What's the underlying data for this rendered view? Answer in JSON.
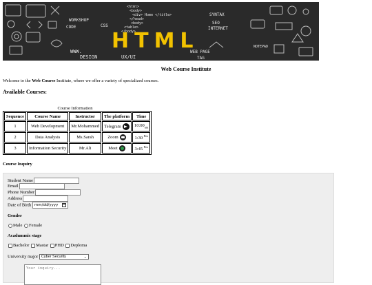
{
  "banner": {
    "title": "HTML",
    "words": [
      "<html>",
      "<body>",
      "<div>",
      "Home",
      "</title>",
      "</head>",
      "<body>",
      "<table>",
      "</body>",
      "</html>",
      "WORKSHOP",
      "CODE",
      "CSS",
      "SYNTAX",
      "SEO",
      "INTERNET",
      "HTML",
      "NOTEPAD",
      "WWW.",
      "DESIGN",
      "UX/UI",
      "WEB PAGE",
      "TAG"
    ]
  },
  "site": {
    "title": "Web Course Institute",
    "welcome_prefix": "Welcome to the ",
    "welcome_brand": "Web Course",
    "welcome_suffix": " Institute, where we offer a variety of specialized courses."
  },
  "courses": {
    "heading": "Available Courses:",
    "caption": "Course Information",
    "headers": [
      "Sequence",
      "Course Name",
      "Instructor",
      "The platform",
      "Time"
    ],
    "rows": [
      {
        "seq": "1",
        "name": "Web Development",
        "instructor": "Mr.Mohammed",
        "platform": "Telegram",
        "platform_icon": "telegram-icon",
        "time": "10:00",
        "time_suffix": "am",
        "suffix_pos": "sub"
      },
      {
        "seq": "2",
        "name": "Data Analysis",
        "instructor": "Ms.Sarah",
        "platform": "Zoom",
        "platform_icon": "zoom-icon",
        "time": "1:30",
        "time_suffix": "Pm",
        "suffix_pos": "sup"
      },
      {
        "seq": "3",
        "name": "Information Security",
        "instructor": "Mr.Ali",
        "platform": "Meet",
        "platform_icon": "meet-icon",
        "time": "3:45",
        "time_suffix": "Pm",
        "suffix_pos": "sup"
      }
    ]
  },
  "inquiry": {
    "heading": "Course Inquiry",
    "student_name_label": "Student Name",
    "email_label": "Email",
    "phone_label": "Phone Number",
    "address_label": "Address",
    "dob_label": "Date of Birth",
    "dob_placeholder": "mm/dd/yyyy",
    "gender_heading": "Gender",
    "gender_options": [
      "Male",
      "Female"
    ],
    "academic_heading": "Acadummic stage",
    "academic_options": [
      "Bachelor",
      "Mastar",
      "PHD",
      "Deploma"
    ],
    "major_label": "University major",
    "major_selected": "Cyber Security",
    "inquiry_placeholder": "Your inquiry..."
  }
}
